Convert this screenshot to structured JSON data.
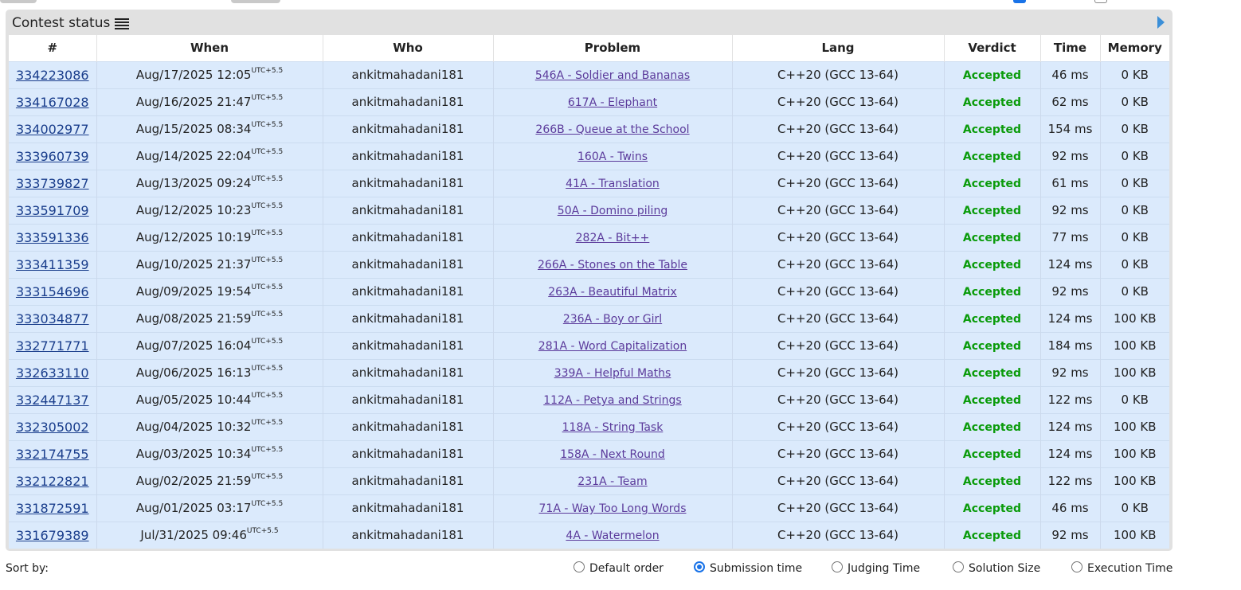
{
  "panel": {
    "title": "Contest status",
    "title_icon": "list-icon",
    "expand_icon": "triangle-right-icon"
  },
  "columns": [
    "#",
    "When",
    "Who",
    "Problem",
    "Lang",
    "Verdict",
    "Time",
    "Memory"
  ],
  "rows": [
    {
      "id": "334223086",
      "when": "Aug/17/2025 12:05",
      "tz": "UTC+5.5",
      "who": "ankitmahadani181",
      "problem": "546A - Soldier and Bananas",
      "lang": "C++20 (GCC 13-64)",
      "verdict": "Accepted",
      "time": "46 ms",
      "memory": "0 KB"
    },
    {
      "id": "334167028",
      "when": "Aug/16/2025 21:47",
      "tz": "UTC+5.5",
      "who": "ankitmahadani181",
      "problem": "617A - Elephant",
      "lang": "C++20 (GCC 13-64)",
      "verdict": "Accepted",
      "time": "62 ms",
      "memory": "0 KB"
    },
    {
      "id": "334002977",
      "when": "Aug/15/2025 08:34",
      "tz": "UTC+5.5",
      "who": "ankitmahadani181",
      "problem": "266B - Queue at the School",
      "lang": "C++20 (GCC 13-64)",
      "verdict": "Accepted",
      "time": "154 ms",
      "memory": "0 KB"
    },
    {
      "id": "333960739",
      "when": "Aug/14/2025 22:04",
      "tz": "UTC+5.5",
      "who": "ankitmahadani181",
      "problem": "160A - Twins",
      "lang": "C++20 (GCC 13-64)",
      "verdict": "Accepted",
      "time": "92 ms",
      "memory": "0 KB"
    },
    {
      "id": "333739827",
      "when": "Aug/13/2025 09:24",
      "tz": "UTC+5.5",
      "who": "ankitmahadani181",
      "problem": "41A - Translation",
      "lang": "C++20 (GCC 13-64)",
      "verdict": "Accepted",
      "time": "61 ms",
      "memory": "0 KB"
    },
    {
      "id": "333591709",
      "when": "Aug/12/2025 10:23",
      "tz": "UTC+5.5",
      "who": "ankitmahadani181",
      "problem": "50A - Domino piling",
      "lang": "C++20 (GCC 13-64)",
      "verdict": "Accepted",
      "time": "92 ms",
      "memory": "0 KB"
    },
    {
      "id": "333591336",
      "when": "Aug/12/2025 10:19",
      "tz": "UTC+5.5",
      "who": "ankitmahadani181",
      "problem": "282A - Bit++",
      "lang": "C++20 (GCC 13-64)",
      "verdict": "Accepted",
      "time": "77 ms",
      "memory": "0 KB"
    },
    {
      "id": "333411359",
      "when": "Aug/10/2025 21:37",
      "tz": "UTC+5.5",
      "who": "ankitmahadani181",
      "problem": "266A - Stones on the Table",
      "lang": "C++20 (GCC 13-64)",
      "verdict": "Accepted",
      "time": "124 ms",
      "memory": "0 KB"
    },
    {
      "id": "333154696",
      "when": "Aug/09/2025 19:54",
      "tz": "UTC+5.5",
      "who": "ankitmahadani181",
      "problem": "263A - Beautiful Matrix",
      "lang": "C++20 (GCC 13-64)",
      "verdict": "Accepted",
      "time": "92 ms",
      "memory": "0 KB"
    },
    {
      "id": "333034877",
      "when": "Aug/08/2025 21:59",
      "tz": "UTC+5.5",
      "who": "ankitmahadani181",
      "problem": "236A - Boy or Girl",
      "lang": "C++20 (GCC 13-64)",
      "verdict": "Accepted",
      "time": "124 ms",
      "memory": "100 KB"
    },
    {
      "id": "332771771",
      "when": "Aug/07/2025 16:04",
      "tz": "UTC+5.5",
      "who": "ankitmahadani181",
      "problem": "281A - Word Capitalization",
      "lang": "C++20 (GCC 13-64)",
      "verdict": "Accepted",
      "time": "184 ms",
      "memory": "100 KB"
    },
    {
      "id": "332633110",
      "when": "Aug/06/2025 16:13",
      "tz": "UTC+5.5",
      "who": "ankitmahadani181",
      "problem": "339A - Helpful Maths",
      "lang": "C++20 (GCC 13-64)",
      "verdict": "Accepted",
      "time": "92 ms",
      "memory": "100 KB"
    },
    {
      "id": "332447137",
      "when": "Aug/05/2025 10:44",
      "tz": "UTC+5.5",
      "who": "ankitmahadani181",
      "problem": "112A - Petya and Strings",
      "lang": "C++20 (GCC 13-64)",
      "verdict": "Accepted",
      "time": "122 ms",
      "memory": "0 KB"
    },
    {
      "id": "332305002",
      "when": "Aug/04/2025 10:32",
      "tz": "UTC+5.5",
      "who": "ankitmahadani181",
      "problem": "118A - String Task",
      "lang": "C++20 (GCC 13-64)",
      "verdict": "Accepted",
      "time": "124 ms",
      "memory": "100 KB"
    },
    {
      "id": "332174755",
      "when": "Aug/03/2025 10:34",
      "tz": "UTC+5.5",
      "who": "ankitmahadani181",
      "problem": "158A - Next Round",
      "lang": "C++20 (GCC 13-64)",
      "verdict": "Accepted",
      "time": "124 ms",
      "memory": "100 KB"
    },
    {
      "id": "332122821",
      "when": "Aug/02/2025 21:59",
      "tz": "UTC+5.5",
      "who": "ankitmahadani181",
      "problem": "231A - Team",
      "lang": "C++20 (GCC 13-64)",
      "verdict": "Accepted",
      "time": "122 ms",
      "memory": "100 KB"
    },
    {
      "id": "331872591",
      "when": "Aug/01/2025 03:17",
      "tz": "UTC+5.5",
      "who": "ankitmahadani181",
      "problem": "71A - Way Too Long Words",
      "lang": "C++20 (GCC 13-64)",
      "verdict": "Accepted",
      "time": "46 ms",
      "memory": "0 KB"
    },
    {
      "id": "331679389",
      "when": "Jul/31/2025 09:46",
      "tz": "UTC+5.5",
      "who": "ankitmahadani181",
      "problem": "4A - Watermelon",
      "lang": "C++20 (GCC 13-64)",
      "verdict": "Accepted",
      "time": "92 ms",
      "memory": "100 KB"
    }
  ],
  "sort": {
    "label": "Sort by:",
    "options": [
      {
        "label": "Default order",
        "selected": false
      },
      {
        "label": "Submission time",
        "selected": true
      },
      {
        "label": "Judging Time",
        "selected": false
      },
      {
        "label": "Solution Size",
        "selected": false
      },
      {
        "label": "Execution Time",
        "selected": false
      }
    ]
  },
  "colors": {
    "row_bg": "#dbeafc",
    "panel_bg": "#e1e1e1",
    "verdict_accepted": "#0a9b0a",
    "link": "#1a3e8c",
    "problem_link": "#5b3a9b",
    "radio_selected": "#1a73e8"
  }
}
